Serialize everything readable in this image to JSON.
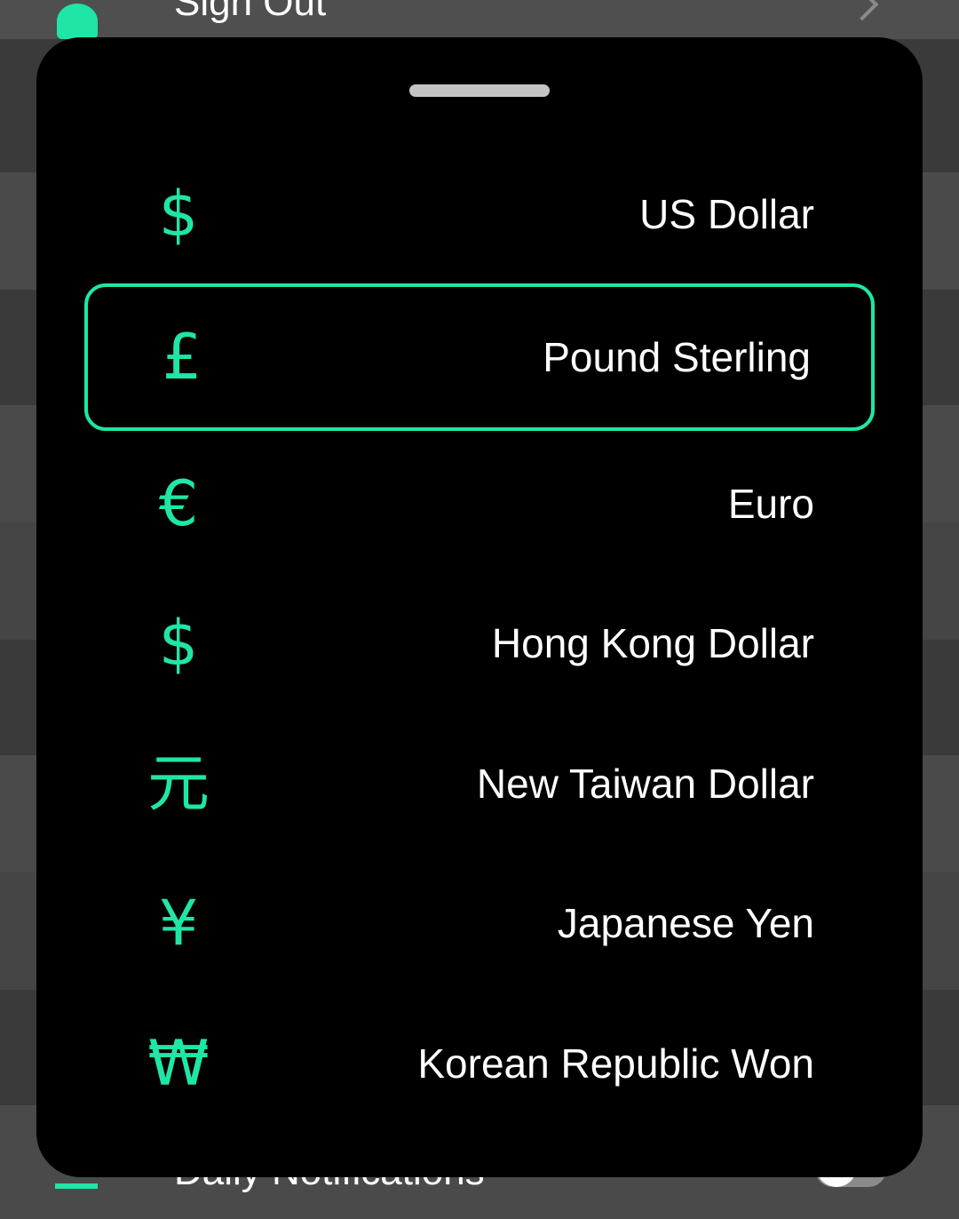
{
  "background": {
    "top_row_label": "Sign Out",
    "bottom_row_label": "Daily Notifications"
  },
  "colors": {
    "accent": "#1fe6a6",
    "sheet": "#000000",
    "text": "#ffffff"
  },
  "currency_list": {
    "selected_index": 1,
    "items": [
      {
        "symbol": "$",
        "label": "US Dollar",
        "icon": "dollar-sign-icon"
      },
      {
        "symbol": "£",
        "label": "Pound Sterling",
        "icon": "pound-sign-icon"
      },
      {
        "symbol": "€",
        "label": "Euro",
        "icon": "euro-sign-icon"
      },
      {
        "symbol": "$",
        "label": "Hong Kong Dollar",
        "icon": "dollar-sign-icon"
      },
      {
        "symbol": "元",
        "label": "New Taiwan Dollar",
        "icon": "yuan-sign-icon"
      },
      {
        "symbol": "¥",
        "label": "Japanese Yen",
        "icon": "yen-sign-icon"
      },
      {
        "symbol": "₩",
        "label": "Korean Republic Won",
        "icon": "won-sign-icon"
      }
    ]
  }
}
